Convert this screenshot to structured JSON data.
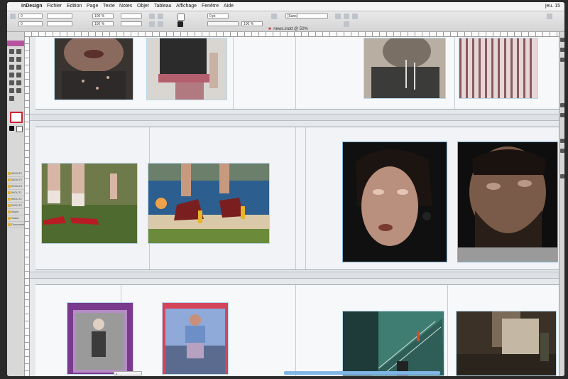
{
  "menubar": {
    "app_name": "InDesign",
    "menus": [
      "Fichier",
      "Edition",
      "Page",
      "Texte",
      "Notes",
      "Objet",
      "Tableau",
      "Affichage",
      "Fenêtre",
      "Aide"
    ],
    "status_right": "jeu. 15"
  },
  "controlbar": {
    "x_value": "0",
    "y_value": "0",
    "scale_x": "100 %",
    "scale_y": "100 %",
    "stroke_weight": "0 pt",
    "opacity": "100 %",
    "style_name": "[Sans]"
  },
  "document": {
    "tab_title": "news.indd @ 50%",
    "page_indicator": "4"
  },
  "tools": {
    "icons": [
      "selection-icon",
      "direct-selection-icon",
      "pen-icon",
      "type-icon",
      "pencil-icon",
      "line-icon",
      "frame-icon",
      "rectangle-icon",
      "scissors-icon",
      "rotate-icon",
      "gradient-icon",
      "hand-icon",
      "zoom-icon"
    ]
  },
  "layers_panel": {
    "rows": [
      "06OUT1",
      "08OUT2",
      "09OUT3",
      "INOUT1",
      "INOUT2",
      "INOUT3",
      "Aspin",
      "Statut",
      "Documents"
    ]
  },
  "layout": {
    "spreads": [
      {
        "name": "spread-1",
        "frames": [
          {
            "name": "photo-glitter-mouth",
            "palette": [
              "#3a3431",
              "#8b6a5e",
              "#c9a89a"
            ]
          },
          {
            "name": "photo-sequin-top-pink-sash",
            "palette": [
              "#2b2b2b",
              "#b45f6e",
              "#d9d6d2"
            ]
          },
          {
            "name": "photo-drooling-man",
            "palette": [
              "#3b3b39",
              "#7a6f64",
              "#b8aea2"
            ]
          },
          {
            "name": "photo-striped-shirt",
            "palette": [
              "#8b5a5e",
              "#caa3a5",
              "#e6d6d6"
            ]
          }
        ]
      },
      {
        "name": "spread-2",
        "frames": [
          {
            "name": "photo-red-heels-grass",
            "palette": [
              "#4e6a2f",
              "#b71c24",
              "#ece3dc"
            ]
          },
          {
            "name": "photo-burgundy-shoes-pool",
            "palette": [
              "#2c5f8f",
              "#7a1f1f",
              "#e8b52a"
            ]
          },
          {
            "name": "photo-woman-face-closeup",
            "palette": [
              "#101010",
              "#b98f7d",
              "#e5c6b6"
            ]
          },
          {
            "name": "photo-bearded-man-closeup",
            "palette": [
              "#0e0e0e",
              "#7a5a48",
              "#b99786"
            ]
          }
        ]
      },
      {
        "name": "spread-3",
        "frames": [
          {
            "name": "photo-figure-purple-card",
            "palette": [
              "#7a3a8e",
              "#b58cc6",
              "#3b3b3b"
            ]
          },
          {
            "name": "photo-denim-jacket-card",
            "palette": [
              "#d4455a",
              "#6c8fc7",
              "#5b6b8f"
            ]
          },
          {
            "name": "photo-green-stairwell",
            "palette": [
              "#3f7d72",
              "#1e3b39",
              "#d84a2d"
            ]
          },
          {
            "name": "photo-dim-interior",
            "palette": [
              "#3b3126",
              "#7a6a57",
              "#c4b8a4"
            ]
          }
        ]
      }
    ]
  }
}
